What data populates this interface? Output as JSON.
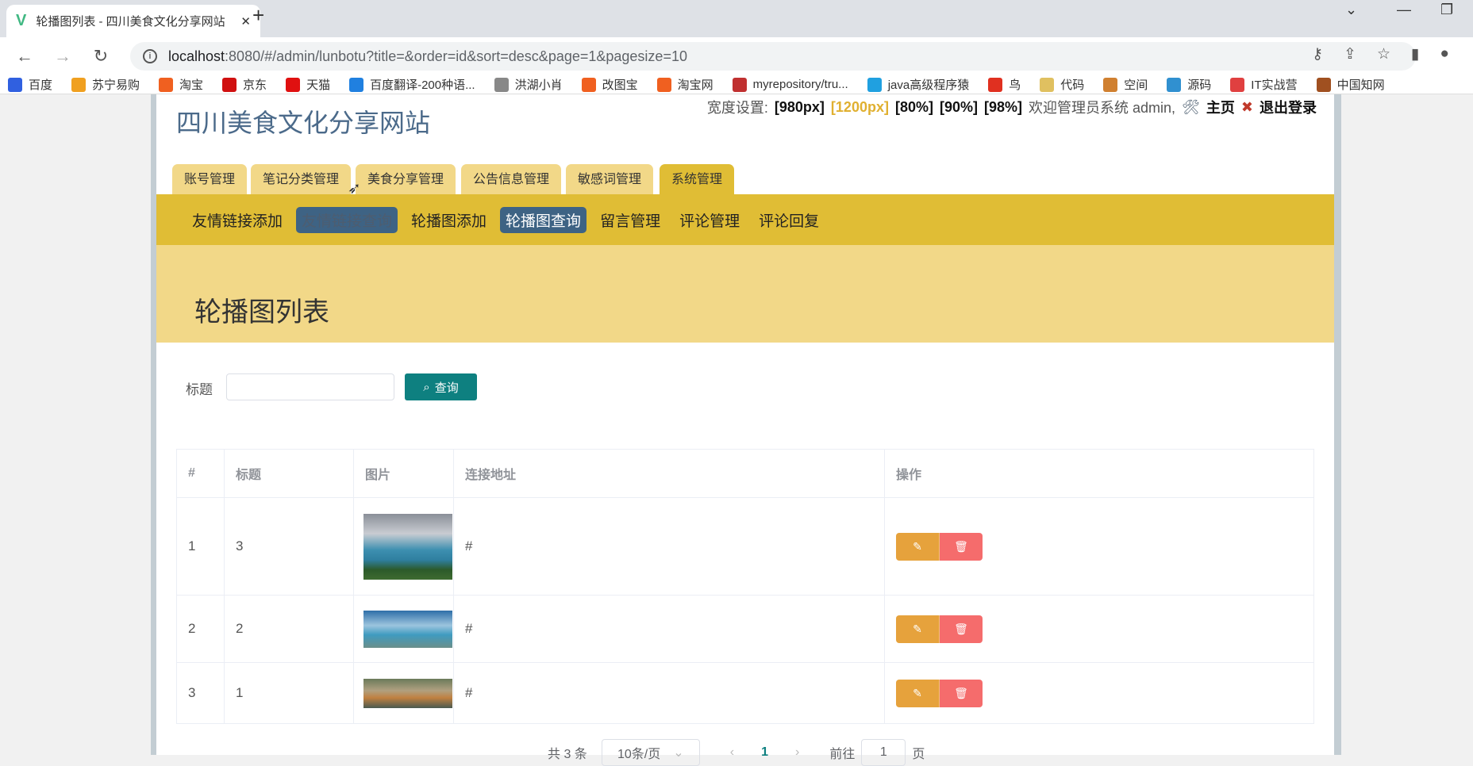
{
  "browser": {
    "tab_title": "轮播图列表 - 四川美食文化分享网站",
    "url_host": "localhost",
    "url_path": ":8080/#/admin/lunbotu?title=&order=id&sort=desc&page=1&pagesize=10",
    "bookmarks": [
      "百度",
      "苏宁易购",
      "淘宝",
      "京东",
      "天猫",
      "百度翻译-200种语...",
      "洪湖小肖",
      "改图宝",
      "淘宝网",
      "myrepository/tru...",
      "java高级程序猿",
      "鸟",
      "代码",
      "空间",
      "源码",
      "IT实战营",
      "中国知网"
    ]
  },
  "site": {
    "title": "四川美食文化分享网站",
    "width_label": "宽度设置:",
    "widths": [
      "[980px]",
      "[1200px]",
      "[80%]",
      "[90%]",
      "[98%]"
    ],
    "welcome": "欢迎管理员系统 admin,",
    "home": "主页",
    "logout": "退出登录"
  },
  "top_tabs": [
    "账号管理",
    "笔记分类管理",
    "美食分享管理",
    "公告信息管理",
    "敏感词管理",
    "系统管理"
  ],
  "sub_nav": [
    "友情链接添加",
    "友情链接查询",
    "轮播图添加",
    "轮播图查询",
    "留言管理",
    "评论管理",
    "评论回复"
  ],
  "page_title": "轮播图列表",
  "search": {
    "label": "标题",
    "value": "",
    "button": "查询"
  },
  "table": {
    "headers": [
      "#",
      "标题",
      "图片",
      "连接地址",
      "操作"
    ],
    "rows": [
      {
        "idx": "1",
        "title": "3",
        "link": "#"
      },
      {
        "idx": "2",
        "title": "2",
        "link": "#"
      },
      {
        "idx": "3",
        "title": "1",
        "link": "#"
      }
    ]
  },
  "pagination": {
    "total": "共 3 条",
    "page_size": "10条/页",
    "current": "1",
    "goto_label": "前往",
    "goto_value": "1",
    "page_suffix": "页"
  },
  "colors": {
    "accent": "#e0bd35",
    "header_bg": "#f2d888",
    "nav_active": "#3e6384",
    "search_btn": "#0e8080",
    "edit": "#e6a23c",
    "delete": "#f56c6c"
  }
}
